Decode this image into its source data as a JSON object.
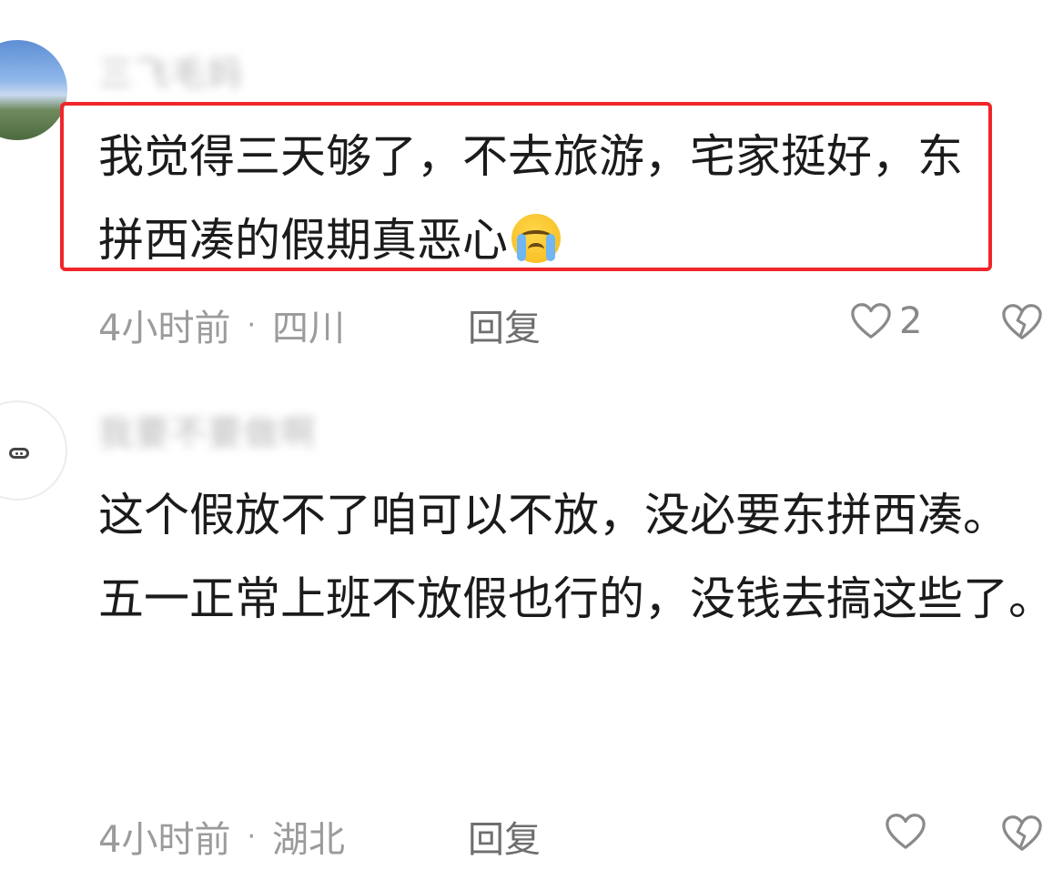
{
  "comments": [
    {
      "avatar": "landscape-avatar",
      "username": "三飞毛妈",
      "text": "我觉得三天够了，不去旅游，宅家挺好，东拼西凑的假期真恶心",
      "emoji": "crying-face-icon",
      "time": "4小时前",
      "location": "四川",
      "reply_label": "回复",
      "likes": "2"
    },
    {
      "avatar": "pig-avatar",
      "username": "我要不要做啊",
      "text": "这个假放不了咱可以不放，没必要东拼西凑。\n五一正常上班不放假也行的，没钱去搞这些了。",
      "time": "4小时前",
      "location": "湖北",
      "reply_label": "回复",
      "likes": ""
    }
  ],
  "separator": "·",
  "colors": {
    "highlight": "#f0262a",
    "meta_text": "#9b9b9b",
    "body_text": "#1b1b1b"
  }
}
